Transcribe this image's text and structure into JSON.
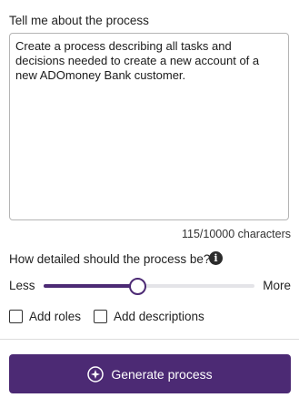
{
  "prompt": {
    "label": "Tell me about the process",
    "value": "Create a process describing all tasks and decisions needed to create a new account of a new ADOmoney Bank customer.",
    "char_count": "115/10000 characters"
  },
  "detail": {
    "label": "How detailed should the process be?",
    "info_icon": "info-icon",
    "slider": {
      "min_label": "Less",
      "max_label": "More",
      "value_fraction": 0.44
    }
  },
  "options": {
    "add_roles": {
      "label": "Add roles",
      "checked": false
    },
    "add_descriptions": {
      "label": "Add descriptions",
      "checked": false
    }
  },
  "actions": {
    "generate_label": "Generate process",
    "generate_icon": "sparkle-icon"
  },
  "colors": {
    "accent": "#4c2a74",
    "track": "#e4e4e8",
    "border": "#b5b5b5"
  }
}
